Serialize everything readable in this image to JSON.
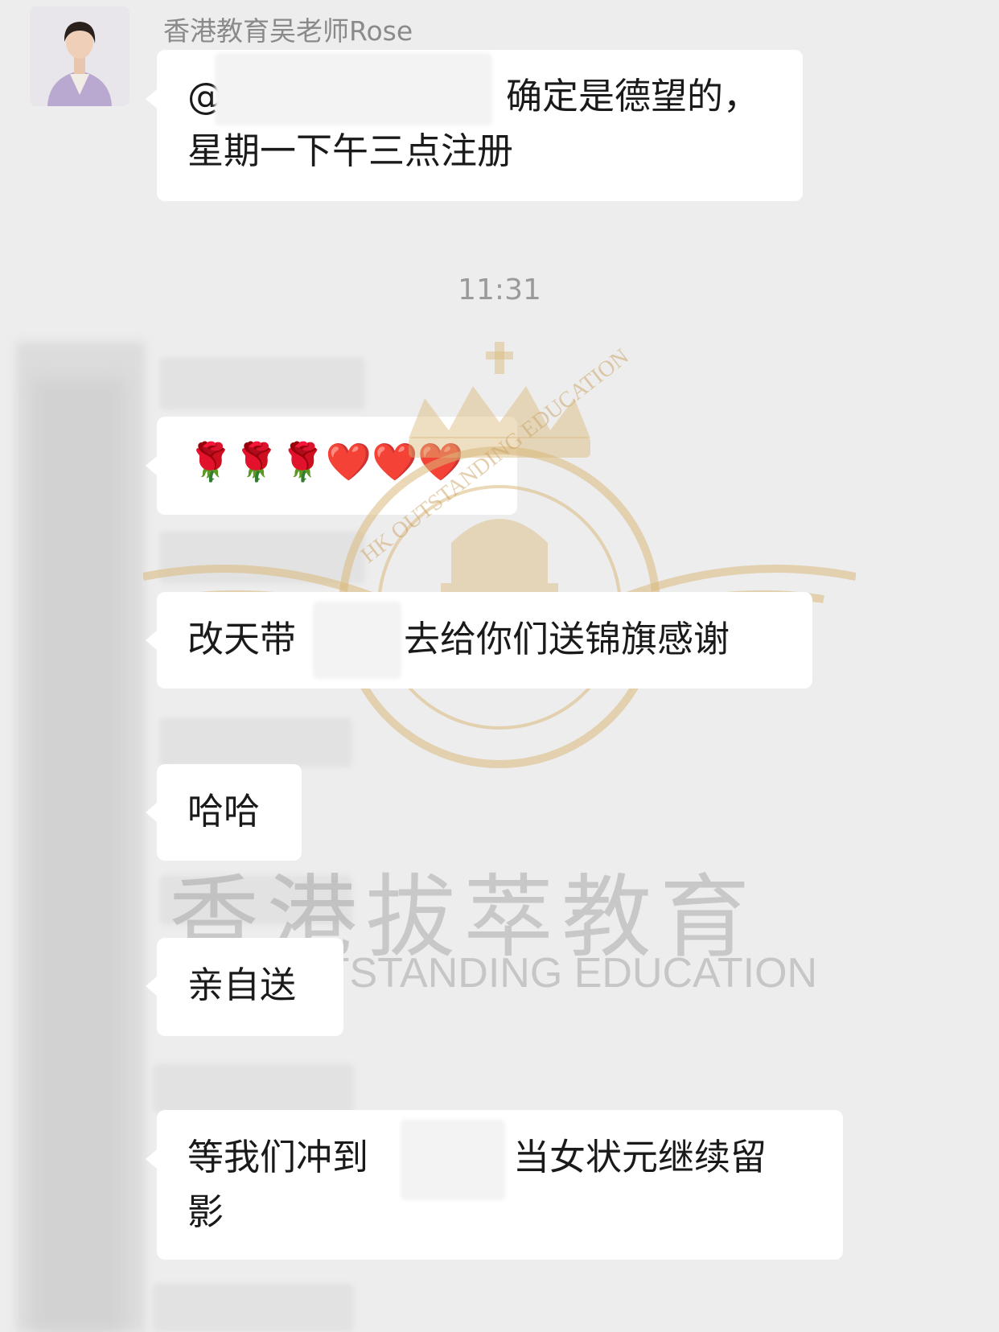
{
  "sender": {
    "name": "香港教育吴老师Rose"
  },
  "messages": {
    "m1_prefix": "@",
    "m1_line1": "确定是德望的，",
    "m1_line2": "星期一下午三点注册",
    "time": "11:31",
    "m2_emoji": "🌹🌹🌹❤️❤️❤️",
    "m3_part1": "改天带",
    "m3_part2": "去给你们送锦旗感谢",
    "m4": "哈哈",
    "m5": "亲自送",
    "m6_part1": "等我们冲到",
    "m6_part2": "当女状元继续留",
    "m6_line2": "影"
  },
  "watermark": {
    "cn": "香港拔萃教育",
    "en": "HK OUTSTANDING EDUCATION",
    "logo_arc_en": "HK OUTSTANDING EDUCATION",
    "logo_arc_cn": "香港拔萃教育"
  },
  "colors": {
    "background": "#ededed",
    "bubble": "#ffffff",
    "logo_gold": "#d9b87a"
  }
}
